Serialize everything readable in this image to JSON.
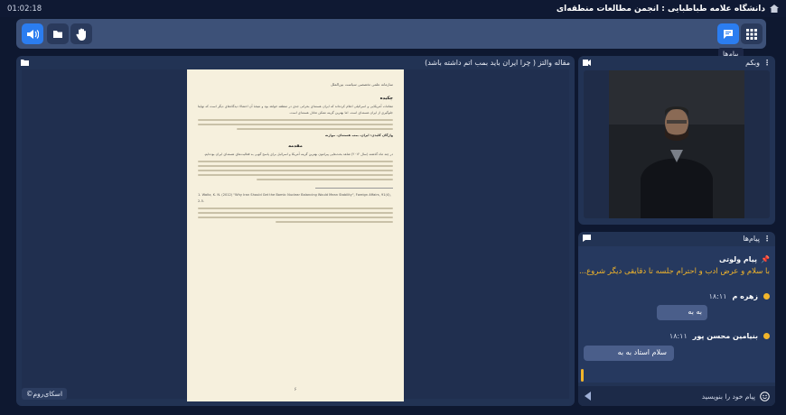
{
  "topbar": {
    "clock": "01:02:18",
    "title": "دانشگاه علامه طباطبایی : انجمن مطالعات منطقه‌ای"
  },
  "toolbar": {
    "tooltip": "پیام‌ها"
  },
  "doc_panel": {
    "title": "مقاله والتز ( چرا ایران باید بمب اتم داشته باشد)",
    "page": {
      "header": "سازمانه علمی تخصصی سیاست بین‌الملل",
      "heading_abstract": "چکیده",
      "abstract": "مقامات آمریکایی و اسرائیلی اعلام کرده‌اند که ایران هسته‌ای بحرانی جدی در منطقه خواهد بود و نتیجهٔ آن احتمالا دیدگاه‌های دیگر است که نهایتا جلوگیری از ایران هسته‌ای است. اما بهترین گزینه ممکن تعادل هسته‌ای است.",
      "keywords": "واژگان کلیدی: ایران، بمب هسته‌ای، موازنه",
      "heading_intro": "مقدمه",
      "intro": "در چند ماه گذشته (سال ۲۰۱۲) شاهد بحث‌هایی پیرامون بهترین گزینه آمریکا و اسرائیل برای پاسخ گویی به فعالیت‌های هسته‌ای ایران بوده‌ایم.",
      "ref": "1. Waltz, K. N. (2012) \"Why Iran Should Get the Bomb: Nuclear Balancing Would Mean Stability\", Foreign Affairs, 91(4), 2-5.",
      "page_number": "۶"
    },
    "brand": "©اسکای‌روم"
  },
  "webcam_panel": {
    "title": "وبکم"
  },
  "messages_panel": {
    "title": "پیام‌ها",
    "pinned": {
      "label": "پیام ولوتی",
      "text": "با سلام و عرض ادب و احترام جلسه تا دقایقی دیگر شروع..."
    },
    "items": [
      {
        "name": "زهره م",
        "time": "۱۸:۱۱",
        "text": "به به"
      },
      {
        "name": "بنیامین محسن پور",
        "time": "۱۸:۱۱",
        "text": "سلام استاد به به"
      }
    ],
    "input_placeholder": "پیام خود را بنویسید"
  },
  "colors": {
    "accent": "#2b7df0",
    "pinned_text": "#f2b52a",
    "panel": "#223354"
  }
}
